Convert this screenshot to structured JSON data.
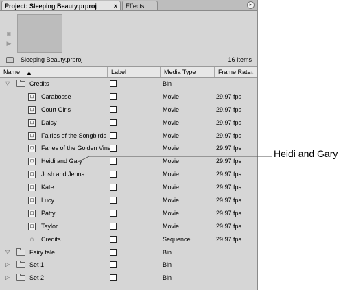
{
  "tabs": {
    "project": "Project: Sleeping Beauty.prproj",
    "project_close": "×",
    "effects": "Effects"
  },
  "panel_menu_icon": "panel-menu-icon",
  "preview": {
    "tools": [
      "camera-icon",
      "play-icon"
    ]
  },
  "project_info": {
    "name": "Sleeping Beauty.prproj",
    "items": "16 Items"
  },
  "columns": {
    "name": "Name",
    "label": "Label",
    "media_type": "Media Type",
    "frame_rate": "Frame Rate"
  },
  "rows": [
    {
      "name": "Credits",
      "type": "folder",
      "indent": 0,
      "expanded": true,
      "media_type": "Bin",
      "frame_rate": ""
    },
    {
      "name": "Carabosse",
      "type": "movie",
      "indent": 1,
      "media_type": "Movie",
      "frame_rate": "29.97 fps"
    },
    {
      "name": "Court Girls",
      "type": "movie",
      "indent": 1,
      "media_type": "Movie",
      "frame_rate": "29.97 fps"
    },
    {
      "name": "Daisy",
      "type": "movie",
      "indent": 1,
      "media_type": "Movie",
      "frame_rate": "29.97 fps"
    },
    {
      "name": "Fairies of the Songbirds",
      "type": "movie",
      "indent": 1,
      "media_type": "Movie",
      "frame_rate": "29.97 fps"
    },
    {
      "name": "Faries of the Golden Vine",
      "type": "movie",
      "indent": 1,
      "media_type": "Movie",
      "frame_rate": "29.97 fps"
    },
    {
      "name": "Heidi and Gary",
      "type": "movie",
      "indent": 1,
      "media_type": "Movie",
      "frame_rate": "29.97 fps"
    },
    {
      "name": "Josh and Jenna",
      "type": "movie",
      "indent": 1,
      "media_type": "Movie",
      "frame_rate": "29.97 fps"
    },
    {
      "name": "Kate",
      "type": "movie",
      "indent": 1,
      "media_type": "Movie",
      "frame_rate": "29.97 fps"
    },
    {
      "name": "Lucy",
      "type": "movie",
      "indent": 1,
      "media_type": "Movie",
      "frame_rate": "29.97 fps"
    },
    {
      "name": "Patty",
      "type": "movie",
      "indent": 1,
      "media_type": "Movie",
      "frame_rate": "29.97 fps"
    },
    {
      "name": "Taylor",
      "type": "movie",
      "indent": 1,
      "media_type": "Movie",
      "frame_rate": "29.97 fps"
    },
    {
      "name": "Credits",
      "type": "sequence",
      "indent": 1,
      "media_type": "Sequence",
      "frame_rate": "29.97 fps"
    },
    {
      "name": "Fairy tale",
      "type": "folder",
      "indent": 0,
      "expanded": true,
      "media_type": "Bin",
      "frame_rate": ""
    },
    {
      "name": "Set 1",
      "type": "folder",
      "indent": 0,
      "expanded": false,
      "media_type": "Bin",
      "frame_rate": ""
    },
    {
      "name": "Set 2",
      "type": "folder",
      "indent": 0,
      "expanded": false,
      "media_type": "Bin",
      "frame_rate": ""
    }
  ],
  "callout": "Heidi and Gary"
}
